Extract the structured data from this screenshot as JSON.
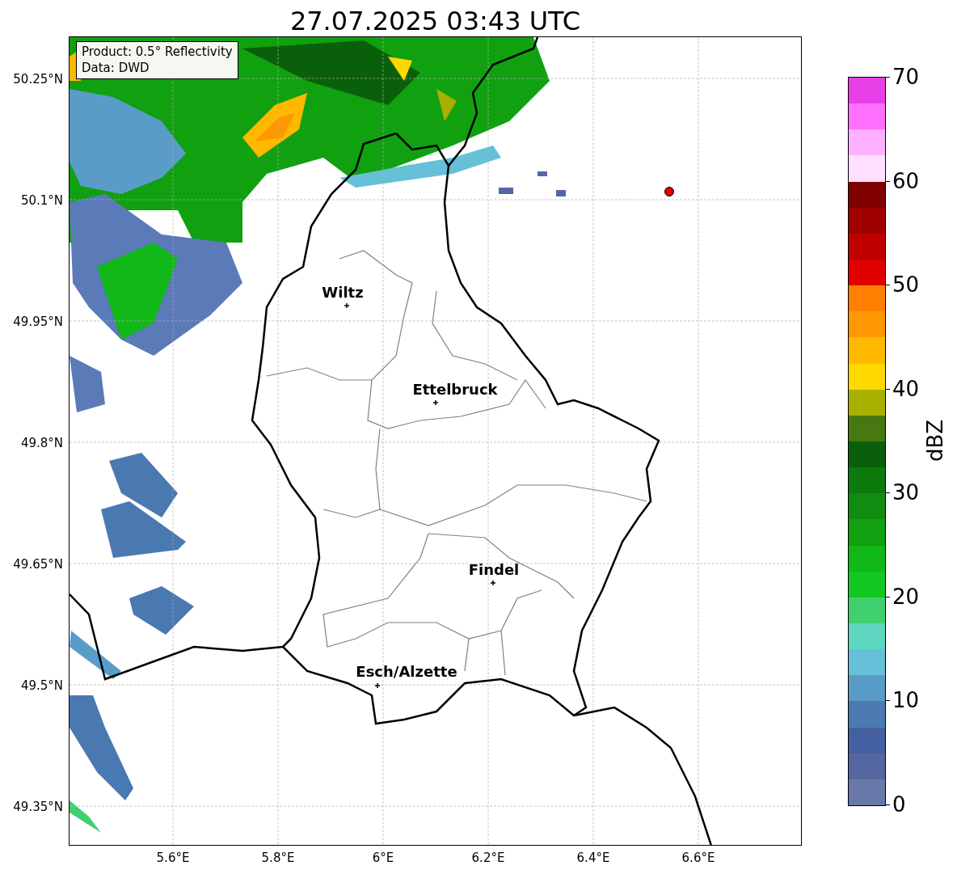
{
  "title": "27.07.2025 03:43 UTC",
  "info_box": {
    "lines": [
      "Product: 0.5° Reflectivity",
      "Data: DWD"
    ]
  },
  "map": {
    "y_ticks": [
      "50.25°N",
      "50.1°N",
      "49.95°N",
      "49.8°N",
      "49.65°N",
      "49.5°N",
      "49.35°N"
    ],
    "x_ticks": [
      "5.6°E",
      "5.8°E",
      "6°E",
      "6.2°E",
      "6.4°E",
      "6.6°E"
    ],
    "cities": [
      {
        "name": "Wiltz"
      },
      {
        "name": "Ettelbruck"
      },
      {
        "name": "Findel"
      },
      {
        "name": "Esch/Alzette"
      }
    ]
  },
  "colorbar": {
    "label": "dBZ",
    "ticks": [
      "70",
      "60",
      "50",
      "40",
      "30",
      "20",
      "10",
      "0"
    ],
    "segments": [
      {
        "color": "#e840e8"
      },
      {
        "color": "#ff70ff"
      },
      {
        "color": "#ffb0ff"
      },
      {
        "color": "#ffe0ff"
      },
      {
        "color": "#800000"
      },
      {
        "color": "#a00000"
      },
      {
        "color": "#c00000"
      },
      {
        "color": "#e00000"
      },
      {
        "color": "#ff8000"
      },
      {
        "color": "#ff9800"
      },
      {
        "color": "#ffb800"
      },
      {
        "color": "#ffd800"
      },
      {
        "color": "#a8b000"
      },
      {
        "color": "#487810"
      },
      {
        "color": "#0a600a"
      },
      {
        "color": "#0c7a0c"
      },
      {
        "color": "#108c10"
      },
      {
        "color": "#10a010"
      },
      {
        "color": "#10b818"
      },
      {
        "color": "#10c820"
      },
      {
        "color": "#40d070"
      },
      {
        "color": "#5ed6c0"
      },
      {
        "color": "#66c0d8"
      },
      {
        "color": "#5a9cc8"
      },
      {
        "color": "#4a7ab0"
      },
      {
        "color": "#4460a0"
      },
      {
        "color": "#5566a0"
      },
      {
        "color": "#6878a8"
      }
    ]
  }
}
